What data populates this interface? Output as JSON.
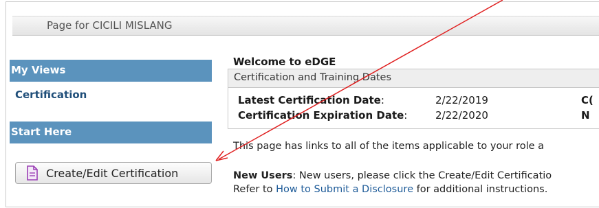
{
  "header": {
    "title": "Page for CICILI MISLANG"
  },
  "sidebar": {
    "my_views_heading": "My Views",
    "certification_link": "Certification",
    "start_here_heading": "Start Here",
    "create_button_label": "Create/Edit Certification"
  },
  "main": {
    "welcome": "Welcome to eDGE",
    "cert_section_title": "Certification and Training Dates",
    "latest_label": "Latest Certification Date",
    "latest_colon": ":",
    "latest_value": "2/22/2019",
    "latest_right_cut": "C(",
    "expiration_label": "Certification Expiration Date",
    "expiration_colon": ":",
    "expiration_value": "2/22/2020",
    "expiration_right_cut": "N",
    "intro_text": "This page has links to all of the items applicable to your role a",
    "new_users_label": "New Users",
    "new_users_text": ":  New users, please click the Create/Edit Certificatio",
    "refer_prefix": "Refer to ",
    "refer_link": "How to Submit a Disclosure",
    "refer_suffix": " for additional instructions."
  },
  "colors": {
    "sidebar_heading_bg": "#5b93bd",
    "annotation_arrow": "#e02020",
    "link": "#1f5c99"
  }
}
